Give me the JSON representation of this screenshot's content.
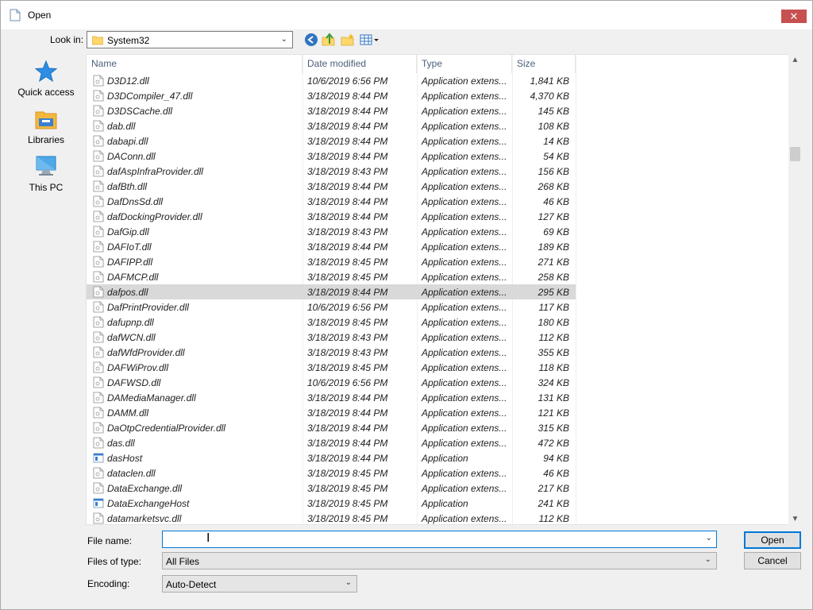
{
  "window": {
    "title": "Open",
    "close_label": "✕"
  },
  "toolbar": {
    "look_in_label": "Look in:",
    "look_in_value": "System32",
    "icons": [
      "back-icon",
      "up-folder-icon",
      "new-folder-icon",
      "view-menu-icon"
    ]
  },
  "places": [
    {
      "label": "Quick access",
      "icon": "star-icon"
    },
    {
      "label": "Libraries",
      "icon": "libraries-icon"
    },
    {
      "label": "This PC",
      "icon": "computer-icon"
    }
  ],
  "columns": {
    "name": "Name",
    "date": "Date modified",
    "type": "Type",
    "size": "Size"
  },
  "files": [
    {
      "name": "D3D12.dll",
      "date": "10/6/2019 6:56 PM",
      "type": "Application extens...",
      "size": "1,841 KB",
      "kind": "dll"
    },
    {
      "name": "D3DCompiler_47.dll",
      "date": "3/18/2019 8:44 PM",
      "type": "Application extens...",
      "size": "4,370 KB",
      "kind": "dll"
    },
    {
      "name": "D3DSCache.dll",
      "date": "3/18/2019 8:44 PM",
      "type": "Application extens...",
      "size": "145 KB",
      "kind": "dll"
    },
    {
      "name": "dab.dll",
      "date": "3/18/2019 8:44 PM",
      "type": "Application extens...",
      "size": "108 KB",
      "kind": "dll"
    },
    {
      "name": "dabapi.dll",
      "date": "3/18/2019 8:44 PM",
      "type": "Application extens...",
      "size": "14 KB",
      "kind": "dll"
    },
    {
      "name": "DAConn.dll",
      "date": "3/18/2019 8:44 PM",
      "type": "Application extens...",
      "size": "54 KB",
      "kind": "dll"
    },
    {
      "name": "dafAspInfraProvider.dll",
      "date": "3/18/2019 8:43 PM",
      "type": "Application extens...",
      "size": "156 KB",
      "kind": "dll"
    },
    {
      "name": "dafBth.dll",
      "date": "3/18/2019 8:44 PM",
      "type": "Application extens...",
      "size": "268 KB",
      "kind": "dll"
    },
    {
      "name": "DafDnsSd.dll",
      "date": "3/18/2019 8:44 PM",
      "type": "Application extens...",
      "size": "46 KB",
      "kind": "dll"
    },
    {
      "name": "dafDockingProvider.dll",
      "date": "3/18/2019 8:44 PM",
      "type": "Application extens...",
      "size": "127 KB",
      "kind": "dll"
    },
    {
      "name": "DafGip.dll",
      "date": "3/18/2019 8:43 PM",
      "type": "Application extens...",
      "size": "69 KB",
      "kind": "dll"
    },
    {
      "name": "DAFIoT.dll",
      "date": "3/18/2019 8:44 PM",
      "type": "Application extens...",
      "size": "189 KB",
      "kind": "dll"
    },
    {
      "name": "DAFIPP.dll",
      "date": "3/18/2019 8:45 PM",
      "type": "Application extens...",
      "size": "271 KB",
      "kind": "dll"
    },
    {
      "name": "DAFMCP.dll",
      "date": "3/18/2019 8:45 PM",
      "type": "Application extens...",
      "size": "258 KB",
      "kind": "dll"
    },
    {
      "name": "dafpos.dll",
      "date": "3/18/2019 8:44 PM",
      "type": "Application extens...",
      "size": "295 KB",
      "kind": "dll",
      "selected": true
    },
    {
      "name": "DafPrintProvider.dll",
      "date": "10/6/2019 6:56 PM",
      "type": "Application extens...",
      "size": "117 KB",
      "kind": "dll"
    },
    {
      "name": "dafupnp.dll",
      "date": "3/18/2019 8:45 PM",
      "type": "Application extens...",
      "size": "180 KB",
      "kind": "dll"
    },
    {
      "name": "dafWCN.dll",
      "date": "3/18/2019 8:43 PM",
      "type": "Application extens...",
      "size": "112 KB",
      "kind": "dll"
    },
    {
      "name": "dafWfdProvider.dll",
      "date": "3/18/2019 8:43 PM",
      "type": "Application extens...",
      "size": "355 KB",
      "kind": "dll"
    },
    {
      "name": "DAFWiProv.dll",
      "date": "3/18/2019 8:45 PM",
      "type": "Application extens...",
      "size": "118 KB",
      "kind": "dll"
    },
    {
      "name": "DAFWSD.dll",
      "date": "10/6/2019 6:56 PM",
      "type": "Application extens...",
      "size": "324 KB",
      "kind": "dll"
    },
    {
      "name": "DAMediaManager.dll",
      "date": "3/18/2019 8:44 PM",
      "type": "Application extens...",
      "size": "131 KB",
      "kind": "dll"
    },
    {
      "name": "DAMM.dll",
      "date": "3/18/2019 8:44 PM",
      "type": "Application extens...",
      "size": "121 KB",
      "kind": "dll"
    },
    {
      "name": "DaOtpCredentialProvider.dll",
      "date": "3/18/2019 8:44 PM",
      "type": "Application extens...",
      "size": "315 KB",
      "kind": "dll"
    },
    {
      "name": "das.dll",
      "date": "3/18/2019 8:44 PM",
      "type": "Application extens...",
      "size": "472 KB",
      "kind": "dll"
    },
    {
      "name": "dasHost",
      "date": "3/18/2019 8:44 PM",
      "type": "Application",
      "size": "94 KB",
      "kind": "exe"
    },
    {
      "name": "dataclen.dll",
      "date": "3/18/2019 8:45 PM",
      "type": "Application extens...",
      "size": "46 KB",
      "kind": "dll"
    },
    {
      "name": "DataExchange.dll",
      "date": "3/18/2019 8:45 PM",
      "type": "Application extens...",
      "size": "217 KB",
      "kind": "dll"
    },
    {
      "name": "DataExchangeHost",
      "date": "3/18/2019 8:45 PM",
      "type": "Application",
      "size": "241 KB",
      "kind": "exe"
    },
    {
      "name": "datamarketsvc.dll",
      "date": "3/18/2019 8:45 PM",
      "type": "Application extens...",
      "size": "112 KB",
      "kind": "dll"
    }
  ],
  "form": {
    "file_name_label": "File name:",
    "file_name_value": "",
    "files_of_type_label": "Files of type:",
    "files_of_type_value": "All Files",
    "encoding_label": "Encoding:",
    "encoding_value": "Auto-Detect",
    "open_label": "Open",
    "cancel_label": "Cancel"
  },
  "colors": {
    "accent": "#0078d7",
    "close_red": "#c75050",
    "selection": "#d9d9d9"
  }
}
